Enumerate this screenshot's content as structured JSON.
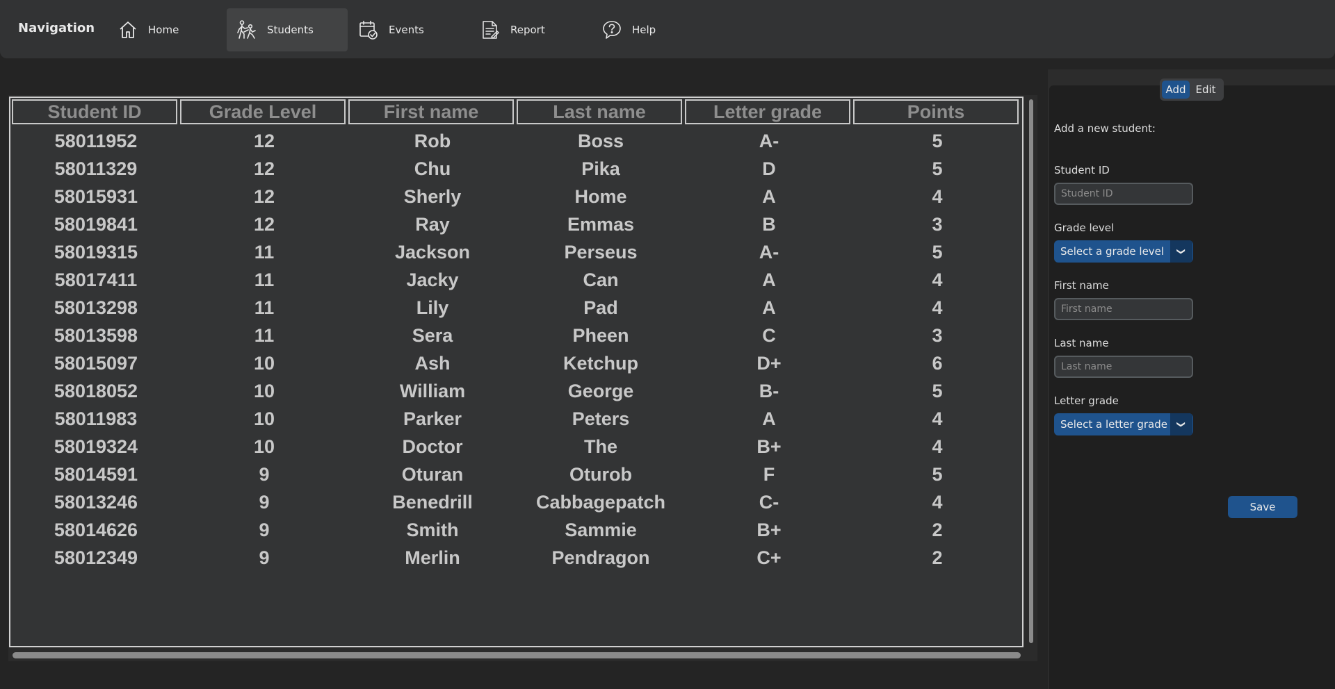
{
  "nav": {
    "title": "Navigation",
    "items": [
      {
        "label": "Home",
        "icon": "home-icon"
      },
      {
        "label": "Students",
        "icon": "students-icon"
      },
      {
        "label": "Events",
        "icon": "calendar-check-icon"
      },
      {
        "label": "Report",
        "icon": "report-icon"
      },
      {
        "label": "Help",
        "icon": "help-icon"
      }
    ],
    "active": "Students"
  },
  "table": {
    "columns": [
      "Student ID",
      "Grade Level",
      "First name",
      "Last name",
      "Letter grade",
      "Points"
    ],
    "rows": [
      [
        "58011952",
        "12",
        "Rob",
        "Boss",
        "A-",
        "5"
      ],
      [
        "58011329",
        "12",
        "Chu",
        "Pika",
        "D",
        "5"
      ],
      [
        "58015931",
        "12",
        "Sherly",
        "Home",
        "A",
        "4"
      ],
      [
        "58019841",
        "12",
        "Ray",
        "Emmas",
        "B",
        "3"
      ],
      [
        "58019315",
        "11",
        "Jackson",
        "Perseus",
        "A-",
        "5"
      ],
      [
        "58017411",
        "11",
        "Jacky",
        "Can",
        "A",
        "4"
      ],
      [
        "58013298",
        "11",
        "Lily",
        "Pad",
        "A",
        "4"
      ],
      [
        "58013598",
        "11",
        "Sera",
        "Pheen",
        "C",
        "3"
      ],
      [
        "58015097",
        "10",
        "Ash",
        "Ketchup",
        "D+",
        "6"
      ],
      [
        "58018052",
        "10",
        "William",
        "George",
        "B-",
        "5"
      ],
      [
        "58011983",
        "10",
        "Parker",
        "Peters",
        "A",
        "4"
      ],
      [
        "58019324",
        "10",
        "Doctor",
        "The",
        "B+",
        "4"
      ],
      [
        "58014591",
        "9",
        "Oturan",
        "Oturob",
        "F",
        "5"
      ],
      [
        "58013246",
        "9",
        "Benedrill",
        "Cabbagepatch",
        "C-",
        "4"
      ],
      [
        "58014626",
        "9",
        "Smith",
        "Sammie",
        "B+",
        "2"
      ],
      [
        "58012349",
        "9",
        "Merlin",
        "Pendragon",
        "C+",
        "2"
      ]
    ]
  },
  "form": {
    "mode_tabs": [
      "Add",
      "Edit"
    ],
    "active_tab": "Add",
    "heading": "Add a new student:",
    "student_id_label": "Student ID",
    "student_id_placeholder": "Student ID",
    "grade_level_label": "Grade level",
    "grade_level_value": "Select a grade level",
    "first_name_label": "First name",
    "first_name_placeholder": "First name",
    "last_name_label": "Last name",
    "last_name_placeholder": "Last name",
    "letter_grade_label": "Letter grade",
    "letter_grade_value": "Select a letter grade",
    "save_label": "Save"
  },
  "colors": {
    "accent": "#1f538d",
    "accent_dark": "#14375e",
    "background": "#242424",
    "panel": "#333435"
  }
}
